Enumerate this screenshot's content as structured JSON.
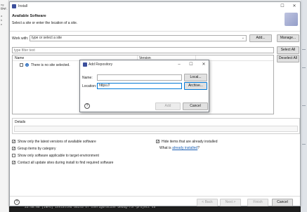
{
  "background": {
    "left_fragments": [
      "ng Plati",
      "ld s...",
      "a",
      "b",
      "e"
    ],
    "console_text": "22:58:08    [INFO] Installed build of configuration debug-for-project 45"
  },
  "window": {
    "title": "Install",
    "header_title": "Available Software",
    "header_desc": "Select a site or enter the location of a site.",
    "work_with_label": "Work with:",
    "work_with_placeholder": "type or select a site",
    "add_button": "Add...",
    "manage_button": "Manage...",
    "filter_placeholder": "type filter text",
    "select_all": "Select All",
    "deselect_all": "Deselect All",
    "columns": [
      "Name",
      "Version"
    ],
    "tree_items": [
      {
        "text": "There is no site selected.",
        "checked": false
      }
    ],
    "details_title": "Details",
    "options_left": [
      {
        "label": "Show only the latest versions of available software",
        "checked": true
      },
      {
        "label": "Group items by category",
        "checked": true
      },
      {
        "label": "Show only software applicable to target environment",
        "checked": false
      },
      {
        "label": "Contact all update sites during install to find required software",
        "checked": true
      }
    ],
    "options_right": [
      {
        "label": "Hide items that are already installed",
        "checked": true
      }
    ],
    "what_is_prefix": "What is",
    "what_is_link": "already installed",
    "what_is_suffix": "?",
    "buttons": {
      "back": "< Back",
      "next": "Next >",
      "finish": "Finish",
      "cancel": "Cancel"
    }
  },
  "dialog": {
    "title": "Add Repository",
    "name_label": "Name:",
    "name_value": "",
    "location_label": "Location:",
    "location_value": "https://",
    "local_button": "Local...",
    "archive_button": "Archive...",
    "add_button": "Add",
    "cancel_button": "Cancel"
  },
  "colors": {
    "accent": "#0078d7",
    "link": "#1a5fb4",
    "brand": "#3c4f9c"
  }
}
